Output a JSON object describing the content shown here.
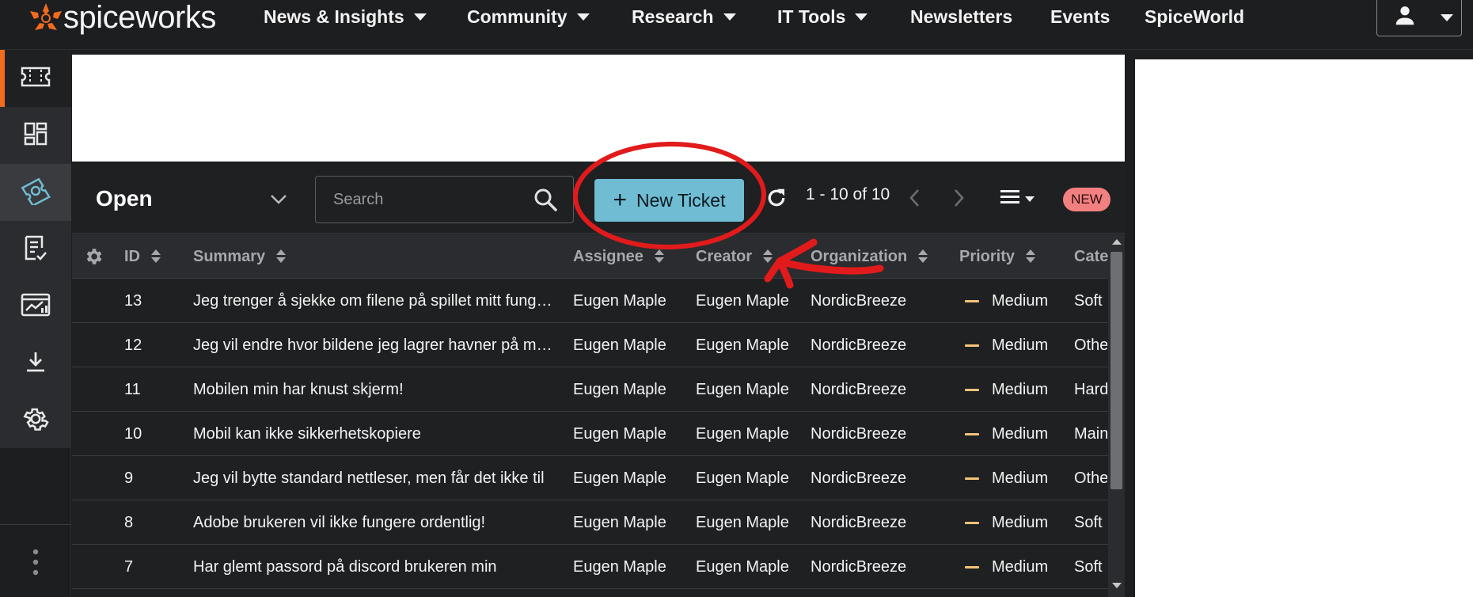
{
  "brand": {
    "name": "spiceworks",
    "accent": "#f26b1d"
  },
  "topnav": {
    "items": [
      {
        "label": "News & Insights",
        "dropdown": true
      },
      {
        "label": "Community",
        "dropdown": true
      },
      {
        "label": "Research",
        "dropdown": true
      },
      {
        "label": "IT Tools",
        "dropdown": true
      },
      {
        "label": "Newsletters",
        "dropdown": false
      },
      {
        "label": "Events",
        "dropdown": false
      },
      {
        "label": "SpiceWorld",
        "dropdown": false
      }
    ],
    "user_icon": "user-icon"
  },
  "rail": {
    "items": [
      {
        "icon": "ticket-icon"
      },
      {
        "icon": "dashboard-icon"
      },
      {
        "icon": "tickets-icon",
        "active": true
      },
      {
        "icon": "reports-icon"
      },
      {
        "icon": "analytics-icon"
      },
      {
        "icon": "download-icon"
      },
      {
        "icon": "gear-icon"
      }
    ],
    "more_icon": "more-vertical-icon"
  },
  "toolbar": {
    "view_label": "Open",
    "search_placeholder": "Search",
    "new_ticket_label": "New Ticket",
    "pager_text": "1 - 10 of 10",
    "new_badge": "NEW",
    "new_ticket_color": "#6fbcd3"
  },
  "table": {
    "columns": [
      "ID",
      "Summary",
      "Assignee",
      "Creator",
      "Organization",
      "Priority",
      "Cate"
    ],
    "rows": [
      {
        "id": "13",
        "summary": "Jeg trenger å sjekke om filene på spillet mitt fungerer",
        "assignee": "Eugen Maple",
        "creator": "Eugen Maple",
        "org": "NordicBreeze",
        "priority": "Medium",
        "category": "Soft"
      },
      {
        "id": "12",
        "summary": "Jeg vil endre hvor bildene jeg lagrer havner på maskinen",
        "assignee": "Eugen Maple",
        "creator": "Eugen Maple",
        "org": "NordicBreeze",
        "priority": "Medium",
        "category": "Othe"
      },
      {
        "id": "11",
        "summary": "Mobilen min har knust skjerm!",
        "assignee": "Eugen Maple",
        "creator": "Eugen Maple",
        "org": "NordicBreeze",
        "priority": "Medium",
        "category": "Hard"
      },
      {
        "id": "10",
        "summary": "Mobil kan ikke sikkerhetskopiere",
        "assignee": "Eugen Maple",
        "creator": "Eugen Maple",
        "org": "NordicBreeze",
        "priority": "Medium",
        "category": "Main"
      },
      {
        "id": "9",
        "summary": "Jeg vil bytte standard nettleser, men får det ikke til",
        "assignee": "Eugen Maple",
        "creator": "Eugen Maple",
        "org": "NordicBreeze",
        "priority": "Medium",
        "category": "Othe"
      },
      {
        "id": "8",
        "summary": "Adobe brukeren vil ikke fungere ordentlig!",
        "assignee": "Eugen Maple",
        "creator": "Eugen Maple",
        "org": "NordicBreeze",
        "priority": "Medium",
        "category": "Soft"
      },
      {
        "id": "7",
        "summary": "Har glemt passord på discord brukeren min",
        "assignee": "Eugen Maple",
        "creator": "Eugen Maple",
        "org": "NordicBreeze",
        "priority": "Medium",
        "category": "Soft"
      }
    ],
    "priority_color": "#f6c27a"
  },
  "annotation": {
    "color": "#e11b1b"
  }
}
